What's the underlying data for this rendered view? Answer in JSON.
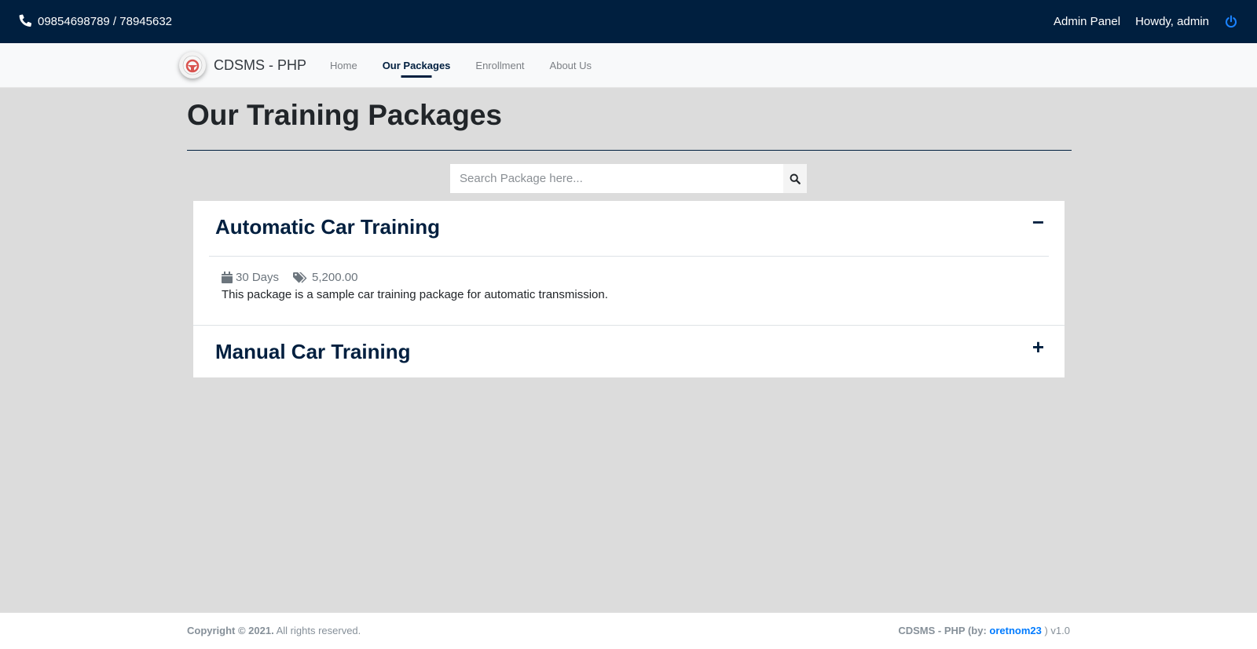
{
  "topbar": {
    "phone_icon": "phone-icon",
    "phone": "09854698789 / 78945632",
    "admin_panel": "Admin Panel",
    "greeting": "Howdy, admin",
    "logout_icon": "power-icon",
    "accent": "#007bff"
  },
  "navbar": {
    "brand": "CDSMS - PHP",
    "links": [
      {
        "label": "Home",
        "active": false
      },
      {
        "label": "Our Packages",
        "active": true
      },
      {
        "label": "Enrollment",
        "active": false
      },
      {
        "label": "About Us",
        "active": false
      }
    ]
  },
  "main": {
    "title": "Our Training Packages",
    "search": {
      "placeholder": "Search Package here...",
      "value": "",
      "icon": "search-icon"
    },
    "packages": [
      {
        "name": "Automatic Car Training",
        "expanded": true,
        "toggle": "−",
        "duration": "30 Days",
        "price": "5,200.00",
        "description": "This package is a sample car training package for automatic transmission."
      },
      {
        "name": "Manual Car Training",
        "expanded": false,
        "toggle": "+"
      }
    ]
  },
  "footer": {
    "copyright_bold": "Copyright © 2021.",
    "copyright_rest": " All rights reserved.",
    "credit_prefix": "CDSMS - PHP (by: ",
    "credit_link": "oretnom23",
    "credit_suffix": " ) v1.0"
  },
  "colors": {
    "primary_dark": "#001f3f",
    "link": "#007bff",
    "background": "#dcdcdc"
  }
}
